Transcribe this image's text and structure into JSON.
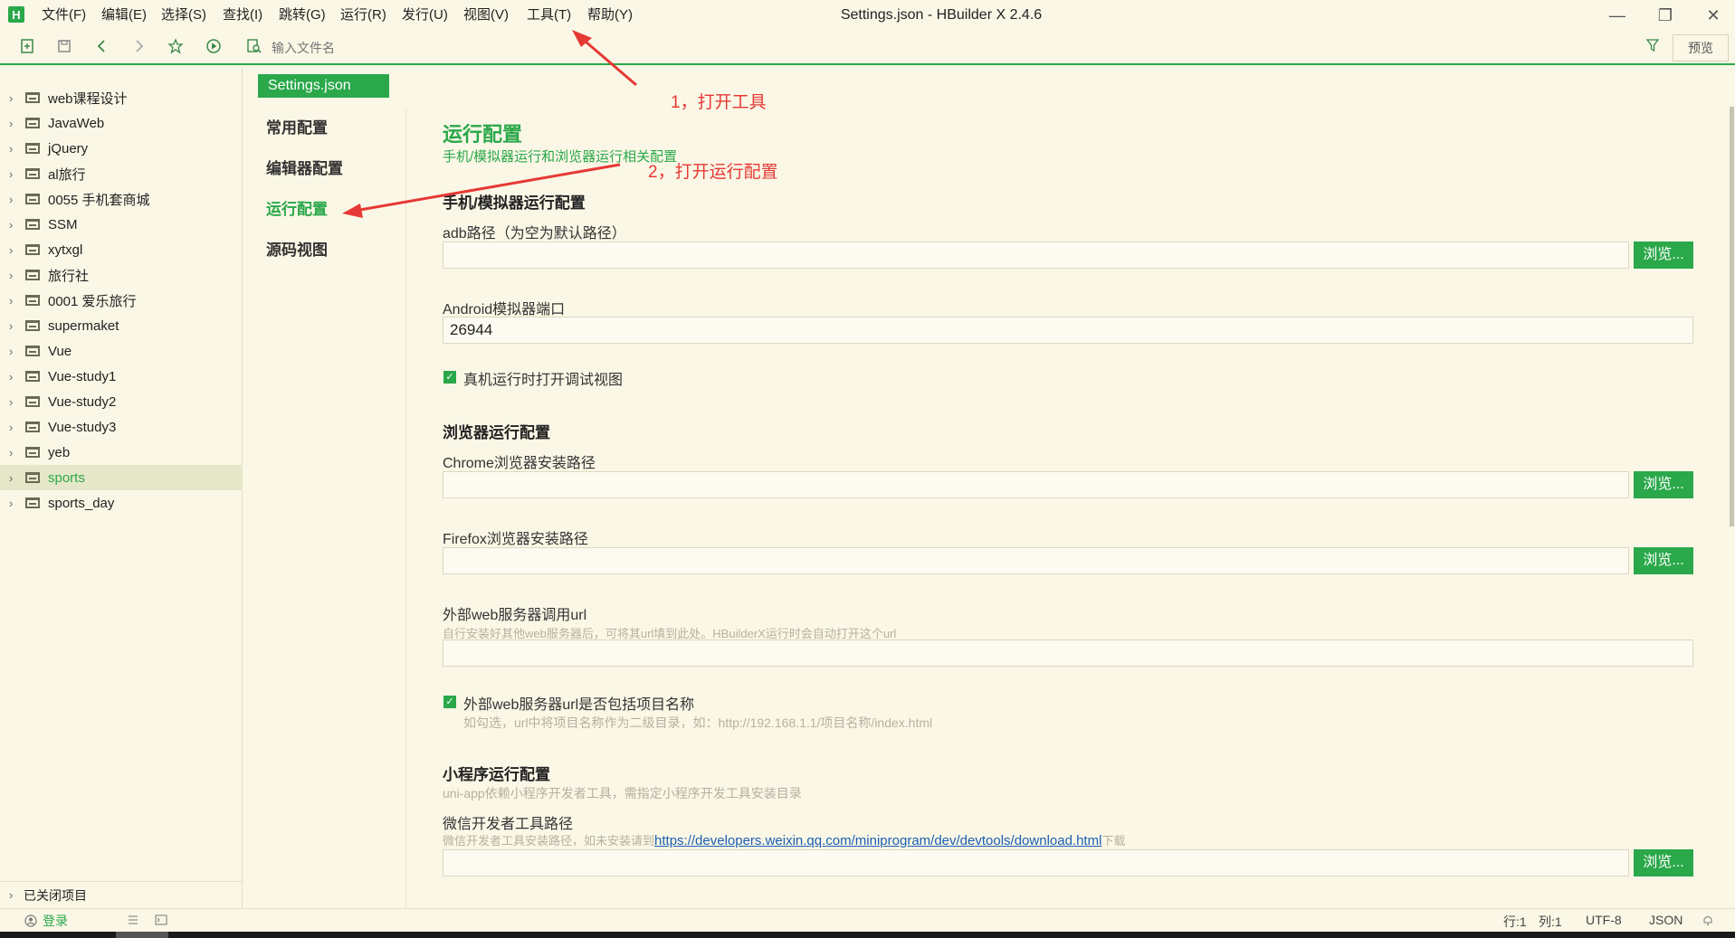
{
  "app": {
    "logo_letter": "H",
    "window_title": "Settings.json - HBuilder X 2.4.6",
    "menu": [
      "文件(F)",
      "编辑(E)",
      "选择(S)",
      "查找(I)",
      "跳转(G)",
      "运行(R)",
      "发行(U)",
      "视图(V)",
      "工具(T)",
      "帮助(Y)"
    ],
    "window_controls": {
      "minimize": "—",
      "restore": "❐",
      "close": "✕"
    }
  },
  "toolbar": {
    "file_input_placeholder": "输入文件名",
    "preview_label": "预览",
    "icons": [
      "new-file-icon",
      "save-icon",
      "back-icon",
      "forward-icon",
      "star-icon",
      "run-icon",
      "search-file-icon",
      "filter-icon"
    ]
  },
  "sidebar": {
    "projects": [
      {
        "name": "web课程设计"
      },
      {
        "name": "JavaWeb"
      },
      {
        "name": "jQuery"
      },
      {
        "name": "al旅行"
      },
      {
        "name": "0055 手机套商城"
      },
      {
        "name": "SSM"
      },
      {
        "name": "xytxgl"
      },
      {
        "name": "旅行社"
      },
      {
        "name": "0001 爱乐旅行"
      },
      {
        "name": "supermaket"
      },
      {
        "name": "Vue"
      },
      {
        "name": "Vue-study1"
      },
      {
        "name": "Vue-study2"
      },
      {
        "name": "Vue-study3"
      },
      {
        "name": "yeb"
      },
      {
        "name": "sports",
        "selected": true
      },
      {
        "name": "sports_day"
      }
    ],
    "closed_projects_label": "已关闭项目"
  },
  "settings": {
    "tab_label": "Settings.json",
    "nav": [
      {
        "label": "常用配置"
      },
      {
        "label": "编辑器配置"
      },
      {
        "label": "运行配置",
        "active": true
      },
      {
        "label": "源码视图"
      }
    ],
    "title": "运行配置",
    "subtitle": "手机/模拟器运行和浏览器运行相关配置",
    "section_mobile": "手机/模拟器运行配置",
    "adb_label": "adb路径（为空为默认路径）",
    "adb_value": "",
    "android_port_label": "Android模拟器端口",
    "android_port_value": "26944",
    "debug_view_label": "真机运行时打开调试视图",
    "section_browser": "浏览器运行配置",
    "chrome_label": "Chrome浏览器安装路径",
    "firefox_label": "Firefox浏览器安装路径",
    "external_web_label": "外部web服务器调用url",
    "external_web_hint": "自行安装好其他web服务器后，可将其url填到此处。HBuilderX运行时会自动打开这个url",
    "include_project_label": "外部web服务器url是否包括项目名称",
    "include_project_hint": "如勾选，url中将项目名称作为二级目录，如：http://192.168.1.1/项目名称/index.html",
    "section_miniprogram": "小程序运行配置",
    "miniprogram_hint": "uni-app依赖小程序开发者工具，需指定小程序开发工具安装目录",
    "wechat_label": "微信开发者工具路径",
    "wechat_hint_prefix": "微信开发者工具安装路径，如未安装请到",
    "wechat_link": "https://developers.weixin.qq.com/miniprogram/dev/devtools/download.html",
    "wechat_hint_suffix": "下载",
    "browse_label": "浏览..."
  },
  "annotations": {
    "step1": "1，打开工具",
    "step2": "2，打开运行配置",
    "color": "#e53935"
  },
  "statusbar": {
    "login_label": "登录",
    "line": "行:1",
    "col": "列:1",
    "encoding": "UTF-8",
    "language": "JSON"
  },
  "colors": {
    "accent": "#2aa84a",
    "background": "#fbf7e6",
    "selected_row": "#e5e7c8"
  }
}
